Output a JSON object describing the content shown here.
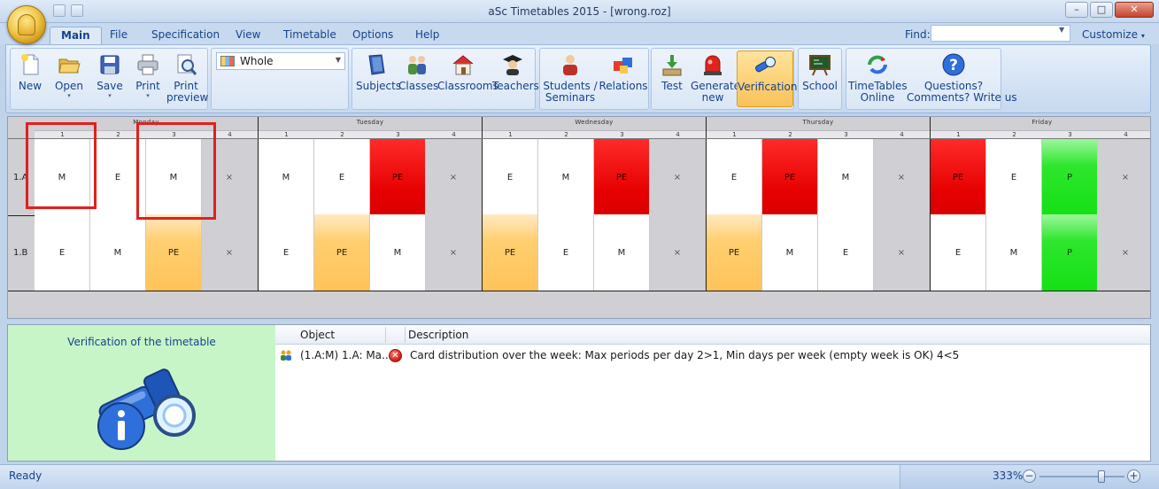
{
  "window": {
    "title": "aSc Timetables 2015  - [wrong.roz]",
    "minimize": "–",
    "maximize": "□",
    "close": "✕"
  },
  "tabs": [
    "Main",
    "File",
    "Specification",
    "View",
    "Timetable",
    "Options",
    "Help"
  ],
  "active_tab": "Main",
  "find": {
    "label": "Find:",
    "value": ""
  },
  "customize": "Customize",
  "ribbon": {
    "file_buttons": [
      {
        "label": "New",
        "icon": "new-file-icon"
      },
      {
        "label": "Open",
        "icon": "open-folder-icon"
      },
      {
        "label": "Save",
        "icon": "save-disk-icon"
      },
      {
        "label": "Print",
        "icon": "printer-icon"
      },
      {
        "label": "Print\npreview",
        "icon": "print-preview-icon"
      }
    ],
    "view_select": "Whole",
    "data_buttons": [
      {
        "label": "Subjects",
        "icon": "book-icon"
      },
      {
        "label": "Classes",
        "icon": "students-icon"
      },
      {
        "label": "Classrooms",
        "icon": "house-icon"
      },
      {
        "label": "Teachers",
        "icon": "graduate-icon"
      },
      {
        "label": "Students /\nSeminars",
        "icon": "student-icon"
      },
      {
        "label": "Relations",
        "icon": "puzzle-icon"
      },
      {
        "label": "Test",
        "icon": "test-icon"
      },
      {
        "label": "Generate\nnew",
        "icon": "siren-icon"
      },
      {
        "label": "Verification",
        "icon": "flashlight-icon"
      },
      {
        "label": "School",
        "icon": "blackboard-icon"
      },
      {
        "label": "TimeTables\nOnline",
        "icon": "sync-icon"
      },
      {
        "label": "Questions?\nComments? Write us",
        "icon": "question-icon"
      }
    ]
  },
  "timetable": {
    "days": [
      "Monday",
      "Tuesday",
      "Wednesday",
      "Thursday",
      "Friday"
    ],
    "periods": [
      "1",
      "2",
      "3",
      "4"
    ],
    "rows": [
      {
        "label": "1.A",
        "cells": [
          {
            "text": "M",
            "style": "white"
          },
          {
            "text": "E",
            "style": "white"
          },
          {
            "text": "M",
            "style": "white"
          },
          {
            "text": "×",
            "style": "empty"
          },
          {
            "text": "M",
            "style": "white"
          },
          {
            "text": "E",
            "style": "white"
          },
          {
            "text": "PE",
            "style": "red"
          },
          {
            "text": "×",
            "style": "empty"
          },
          {
            "text": "E",
            "style": "white"
          },
          {
            "text": "M",
            "style": "white"
          },
          {
            "text": "PE",
            "style": "red"
          },
          {
            "text": "×",
            "style": "empty"
          },
          {
            "text": "E",
            "style": "white"
          },
          {
            "text": "PE",
            "style": "red"
          },
          {
            "text": "M",
            "style": "white"
          },
          {
            "text": "×",
            "style": "empty"
          },
          {
            "text": "PE",
            "style": "red"
          },
          {
            "text": "E",
            "style": "white"
          },
          {
            "text": "P",
            "style": "green"
          },
          {
            "text": "×",
            "style": "empty"
          }
        ]
      },
      {
        "label": "1.B",
        "cells": [
          {
            "text": "E",
            "style": "white"
          },
          {
            "text": "M",
            "style": "white"
          },
          {
            "text": "PE",
            "style": "orange"
          },
          {
            "text": "×",
            "style": "empty"
          },
          {
            "text": "E",
            "style": "white"
          },
          {
            "text": "PE",
            "style": "orange"
          },
          {
            "text": "M",
            "style": "white"
          },
          {
            "text": "×",
            "style": "empty"
          },
          {
            "text": "PE",
            "style": "orange"
          },
          {
            "text": "E",
            "style": "white"
          },
          {
            "text": "M",
            "style": "white"
          },
          {
            "text": "×",
            "style": "empty"
          },
          {
            "text": "PE",
            "style": "orange"
          },
          {
            "text": "M",
            "style": "white"
          },
          {
            "text": "E",
            "style": "white"
          },
          {
            "text": "×",
            "style": "empty"
          },
          {
            "text": "E",
            "style": "white"
          },
          {
            "text": "M",
            "style": "white"
          },
          {
            "text": "P",
            "style": "green"
          },
          {
            "text": "×",
            "style": "empty"
          }
        ]
      }
    ]
  },
  "verification": {
    "title": "Verification of the timetable",
    "columns": {
      "object": "Object",
      "description": "Description"
    },
    "items": [
      {
        "object": "(1.A:M) 1.A: Ma...",
        "description": "Card distribution over the week: Max periods per day 2>1, Min days per week (empty week is OK) 4<5",
        "status_icon": "error-icon"
      }
    ]
  },
  "status": {
    "text": "Ready",
    "zoom": "333%",
    "zoom_minus": "−",
    "zoom_plus": "+"
  },
  "colors": {
    "red_card": "#e60000",
    "orange_card": "#ffc35a",
    "green_card": "#15e015",
    "empty_cell": "#cfcfd4",
    "highlight": "#e0201f",
    "verification_panel": "#c8f5c8"
  }
}
